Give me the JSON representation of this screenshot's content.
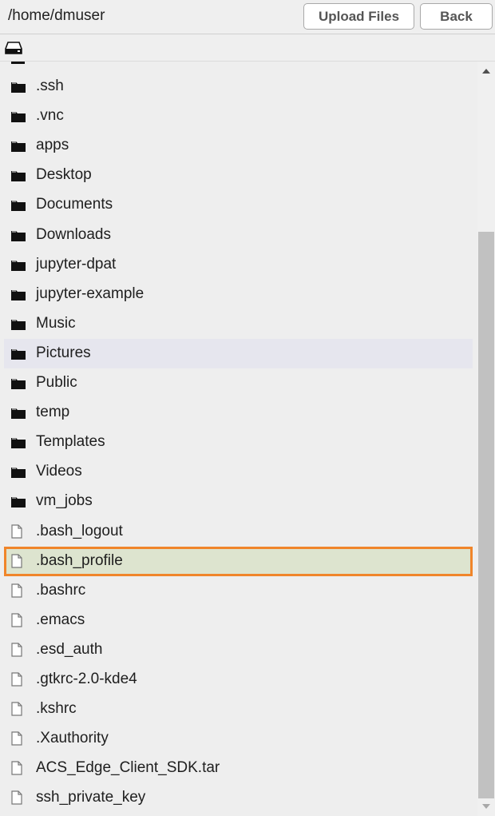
{
  "header": {
    "path": "/home/dmuser",
    "upload_label": "Upload Files",
    "back_label": "Back"
  },
  "colors": {
    "selected_border": "#f0852a",
    "selected_background": "#dde4cf",
    "hover_background": "#e6e6ee"
  },
  "items": [
    {
      "name": ".ssh",
      "type": "folder"
    },
    {
      "name": ".vnc",
      "type": "folder"
    },
    {
      "name": "apps",
      "type": "folder"
    },
    {
      "name": "Desktop",
      "type": "folder"
    },
    {
      "name": "Documents",
      "type": "folder"
    },
    {
      "name": "Downloads",
      "type": "folder"
    },
    {
      "name": "jupyter-dpat",
      "type": "folder"
    },
    {
      "name": "jupyter-example",
      "type": "folder"
    },
    {
      "name": "Music",
      "type": "folder"
    },
    {
      "name": "Pictures",
      "type": "folder",
      "state": "hover"
    },
    {
      "name": "Public",
      "type": "folder"
    },
    {
      "name": "temp",
      "type": "folder"
    },
    {
      "name": "Templates",
      "type": "folder"
    },
    {
      "name": "Videos",
      "type": "folder"
    },
    {
      "name": "vm_jobs",
      "type": "folder"
    },
    {
      "name": ".bash_logout",
      "type": "file"
    },
    {
      "name": ".bash_profile",
      "type": "file",
      "state": "selected"
    },
    {
      "name": ".bashrc",
      "type": "file"
    },
    {
      "name": ".emacs",
      "type": "file"
    },
    {
      "name": ".esd_auth",
      "type": "file"
    },
    {
      "name": ".gtkrc-2.0-kde4",
      "type": "file"
    },
    {
      "name": ".kshrc",
      "type": "file"
    },
    {
      "name": ".Xauthority",
      "type": "file"
    },
    {
      "name": "ACS_Edge_Client_SDK.tar",
      "type": "file"
    },
    {
      "name": "ssh_private_key",
      "type": "file"
    }
  ]
}
